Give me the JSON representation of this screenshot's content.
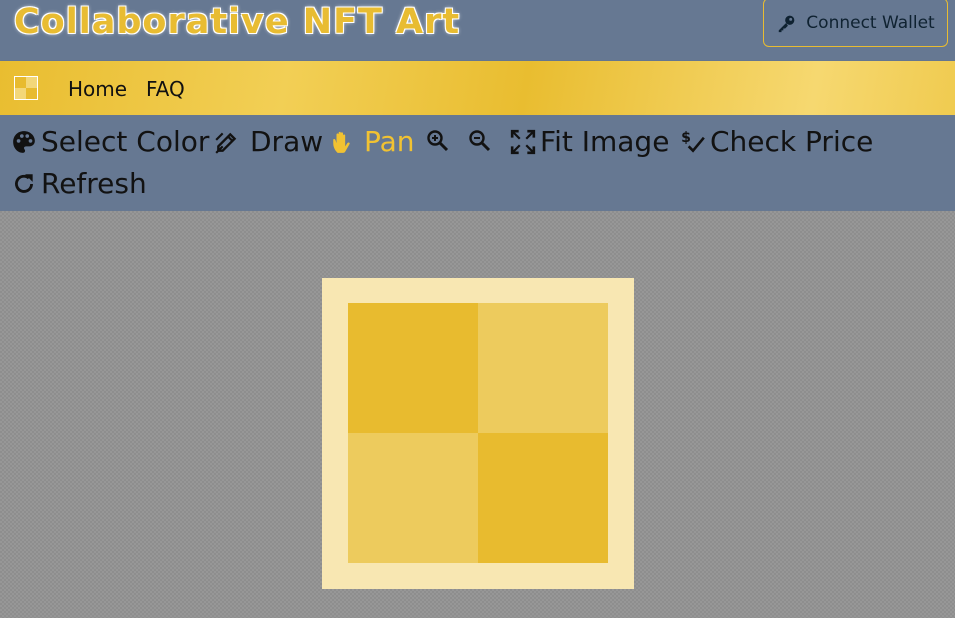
{
  "header": {
    "title": "Collaborative NFT Art",
    "wallet_button": {
      "label": "Connect Wallet",
      "icon": "key-icon"
    }
  },
  "nav": {
    "logo": "checkerboard-logo",
    "links": [
      {
        "label": "Home"
      },
      {
        "label": "FAQ"
      }
    ]
  },
  "toolbar": {
    "tools": [
      {
        "label": "Select Color",
        "icon": "palette-icon",
        "active": false
      },
      {
        "label": "Draw",
        "icon": "pencil-icon",
        "active": false
      },
      {
        "label": "Pan",
        "icon": "hand-icon",
        "active": true
      },
      {
        "label": "",
        "icon": "zoom-in-icon",
        "active": false
      },
      {
        "label": "",
        "icon": "zoom-out-icon",
        "active": false
      },
      {
        "label": "Fit Image",
        "icon": "expand-icon",
        "active": false
      },
      {
        "label": "Check Price",
        "icon": "price-check-icon",
        "active": false
      },
      {
        "label": "Refresh",
        "icon": "refresh-icon",
        "active": false
      }
    ]
  },
  "canvas": {
    "pixels": [
      [
        "#e8bb2f",
        "#edcb5d"
      ],
      [
        "#edcb5d",
        "#e8bb2f"
      ]
    ]
  },
  "colors": {
    "accent": "#e8bc32",
    "header_bg": "#667892",
    "active_tool": "#f1c232",
    "frame": "#f8e7b2"
  }
}
